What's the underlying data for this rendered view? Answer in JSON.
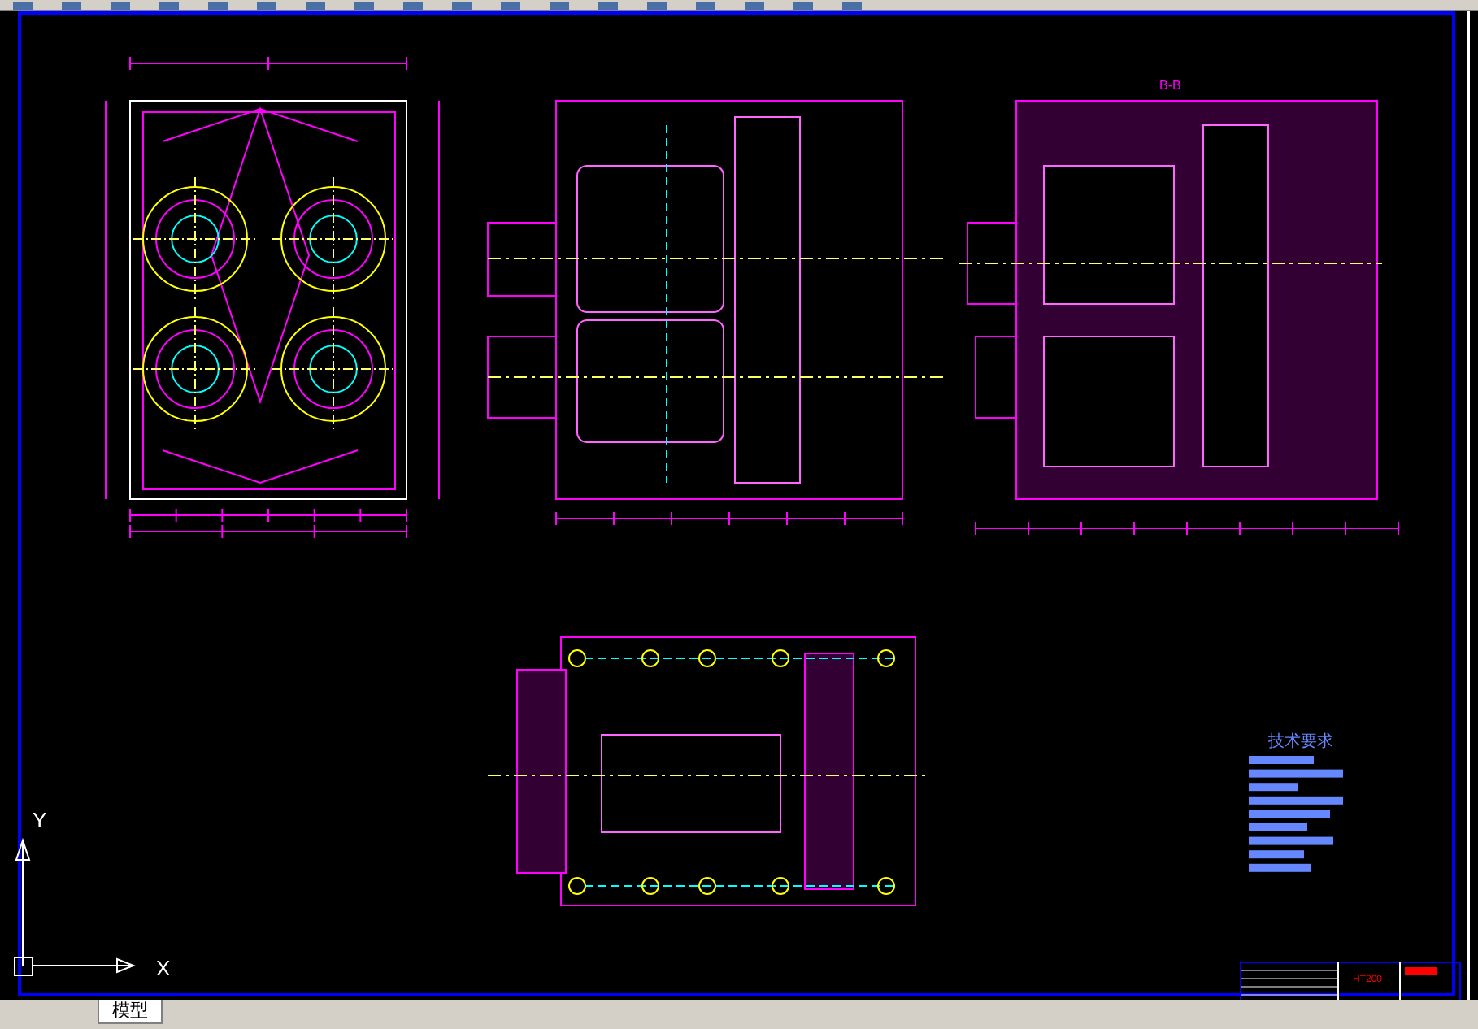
{
  "drawing": {
    "section_label": "B-B",
    "requirements_title": "技术要求",
    "material": "HT200"
  },
  "ucs": {
    "y_label": "Y",
    "x_label": "X"
  },
  "tabs": [
    {
      "label": "模型",
      "selected": true
    }
  ]
}
